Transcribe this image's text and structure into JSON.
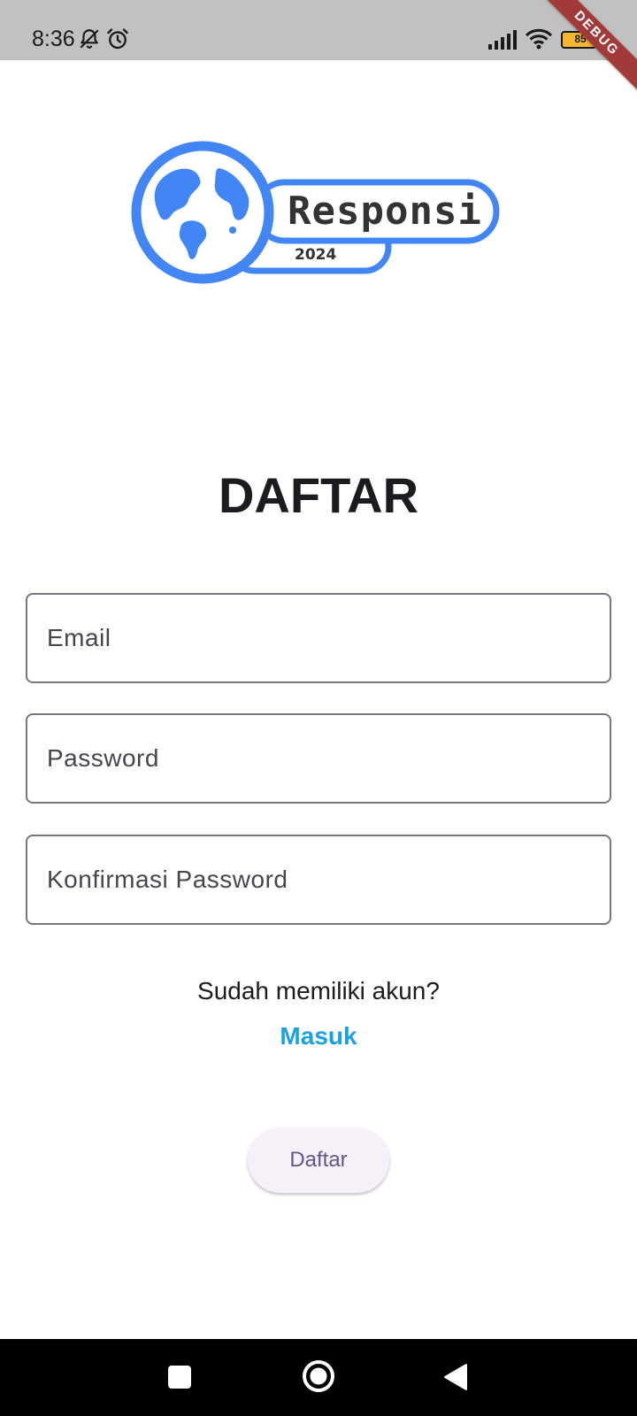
{
  "status_bar": {
    "time": "8:36",
    "battery_level": "85",
    "icons": [
      "notifications-off-icon",
      "alarm-icon",
      "signal-icon",
      "wifi-icon",
      "battery-icon"
    ]
  },
  "debug_banner": {
    "label": "DEBUG"
  },
  "logo": {
    "name": "Responsi",
    "year": "2024",
    "brand_color": "#4285f4"
  },
  "page": {
    "title": "DAFTAR"
  },
  "form": {
    "email": {
      "placeholder": "Email",
      "value": ""
    },
    "password": {
      "placeholder": "Password",
      "value": ""
    },
    "confirm_password": {
      "placeholder": "Konfirmasi Password",
      "value": ""
    }
  },
  "login": {
    "prompt": "Sudah memiliki akun?",
    "link_label": "Masuk",
    "link_color": "#1ba1e2"
  },
  "submit": {
    "label": "Daftar"
  },
  "nav_bar": {
    "icons": [
      "recents-square-icon",
      "home-circle-icon",
      "back-triangle-icon"
    ]
  }
}
